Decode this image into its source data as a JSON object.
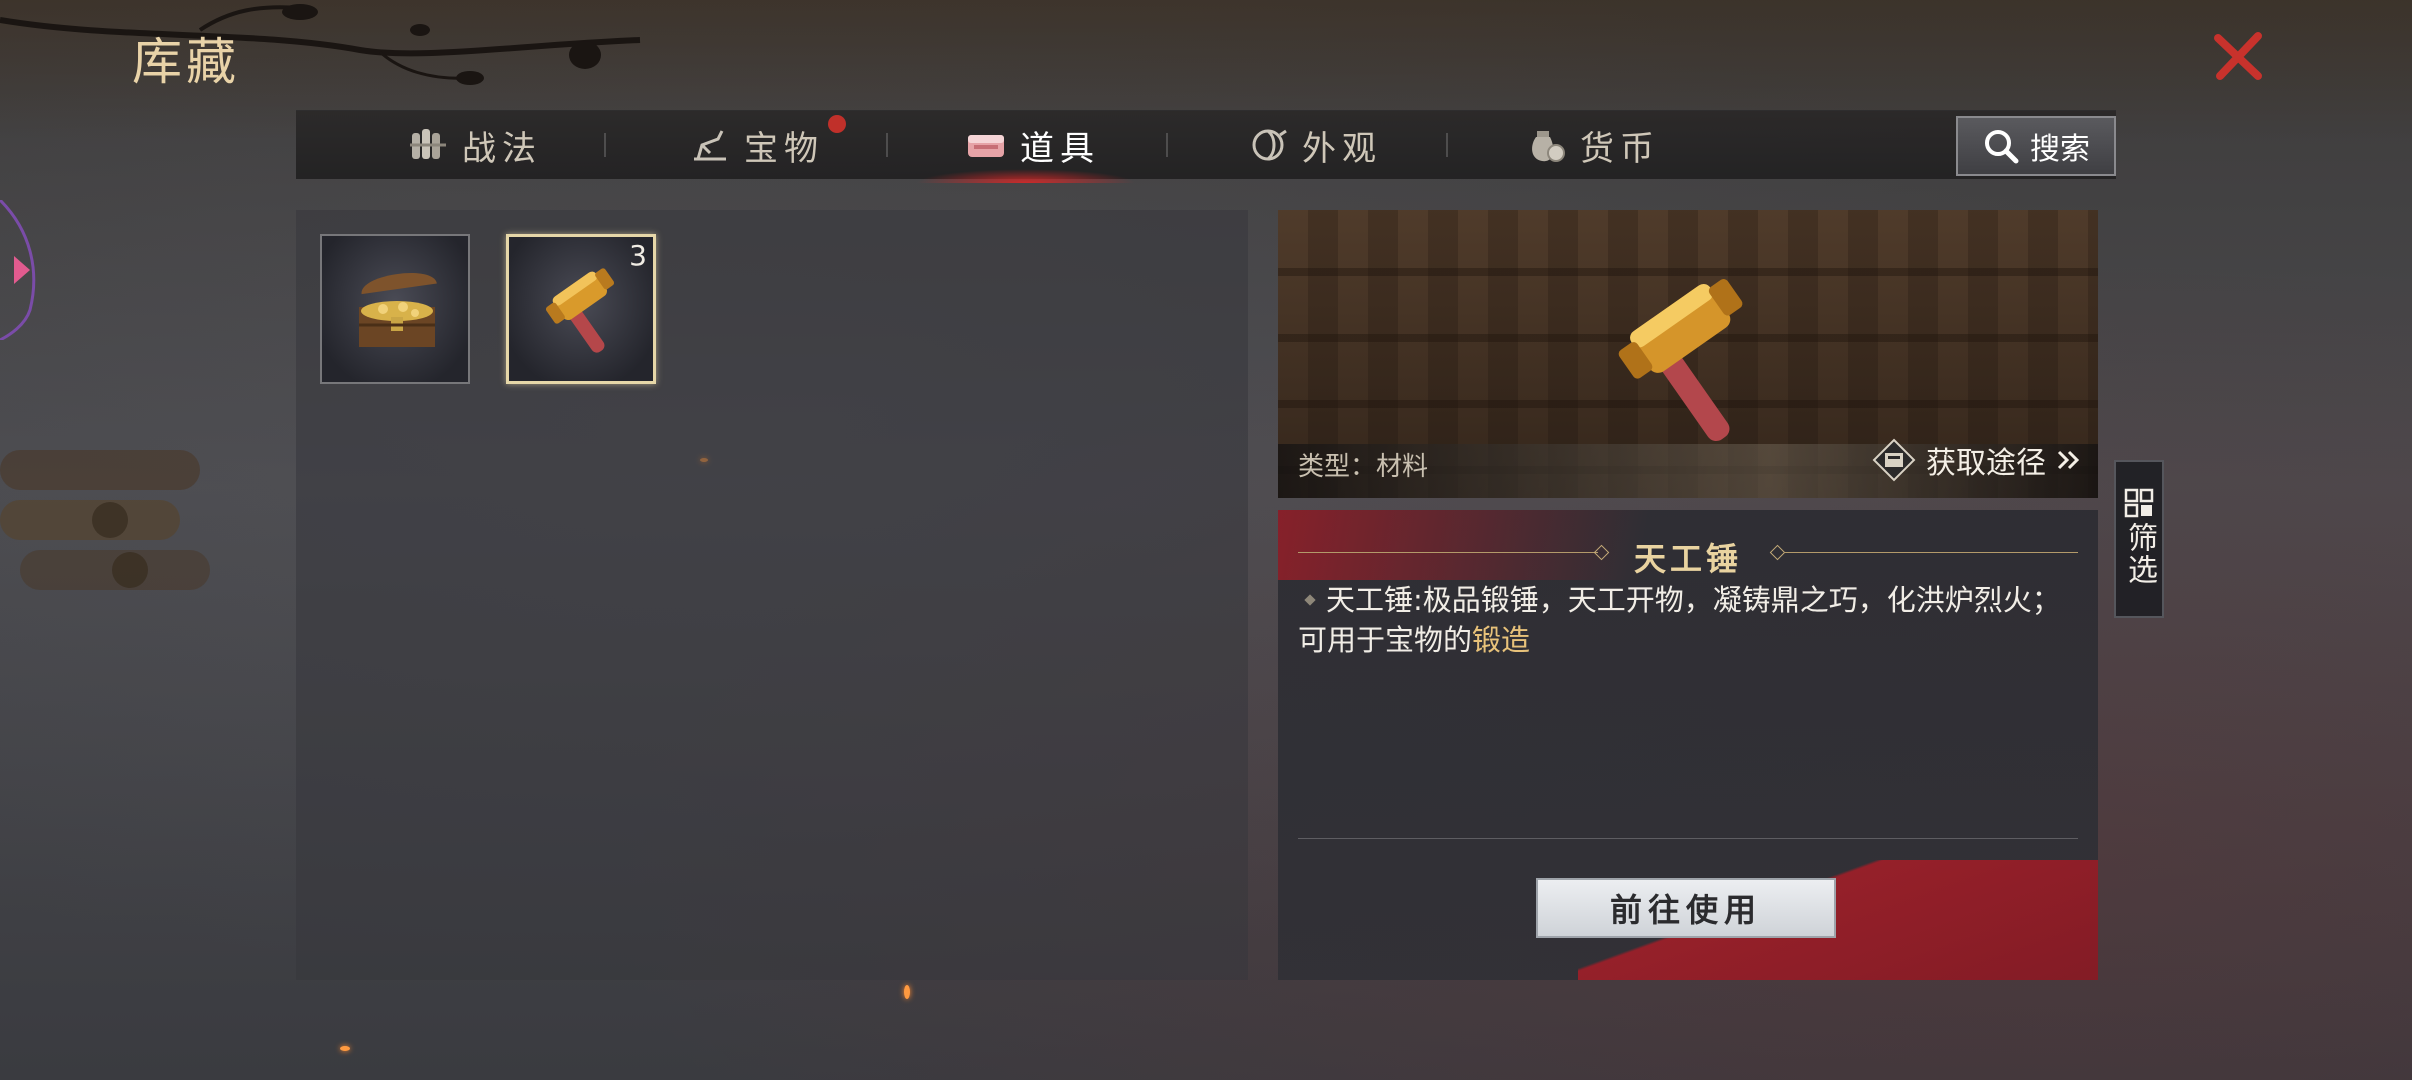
{
  "header": {
    "title": "库藏"
  },
  "tabs": [
    {
      "label": "战法",
      "icon": "scroll-bundle-icon",
      "active": false,
      "has_badge": false
    },
    {
      "label": "宝物",
      "icon": "treasure-icon",
      "active": false,
      "has_badge": true
    },
    {
      "label": "道具",
      "icon": "item-chest-icon",
      "active": true,
      "has_badge": false
    },
    {
      "label": "外观",
      "icon": "appearance-icon",
      "active": false,
      "has_badge": false
    },
    {
      "label": "货币",
      "icon": "coin-bag-icon",
      "active": false,
      "has_badge": false
    }
  ],
  "search": {
    "label": "搜索",
    "icon": "search-icon"
  },
  "inventory": {
    "items": [
      {
        "name": "treasure-chest",
        "icon": "treasure-chest-icon",
        "count": "",
        "selected": false
      },
      {
        "name": "天工锤",
        "icon": "hammer-icon",
        "count": "3",
        "selected": true
      }
    ]
  },
  "detail": {
    "type_label": "类型：材料",
    "obtain_label": "获取途径",
    "name": "天工锤",
    "description": "天工锤:极品锻锤，天工开物，凝铸鼎之巧，化洪炉烈火；可用于宝物的",
    "description_highlight": "锻造",
    "use_button": "前往使用"
  },
  "filter": {
    "label": "筛选"
  },
  "colors": {
    "accent_red": "#c0302a",
    "gold_text": "#e9d3a0",
    "highlight": "#e8c27a"
  }
}
